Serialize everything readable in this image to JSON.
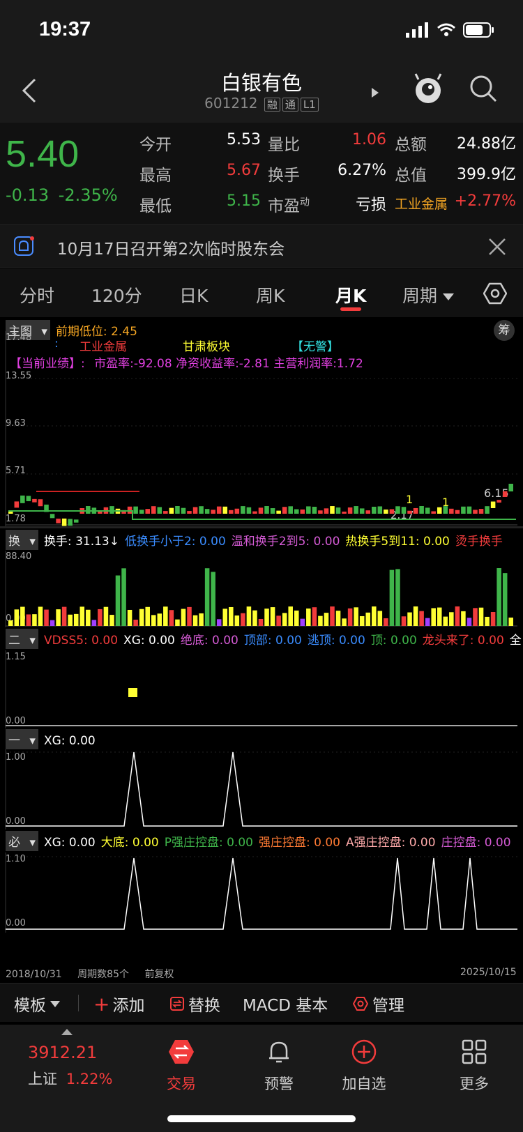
{
  "status": {
    "time": "19:37"
  },
  "header": {
    "title": "白银有色",
    "code": "601212",
    "badges": [
      "融",
      "通",
      "L1"
    ]
  },
  "quote": {
    "price": "5.40",
    "change": "-0.13",
    "change_pct": "-2.35%",
    "fields": {
      "open_label": "今开",
      "open": "5.53",
      "high_label": "最高",
      "high": "5.67",
      "low_label": "最低",
      "low": "5.15",
      "vol_ratio_label": "量比",
      "vol_ratio": "1.06",
      "turnover_label": "换手",
      "turnover": "6.27%",
      "pe_label": "市盈",
      "pe_sup": "动",
      "pe": "亏损",
      "amount_label": "总额",
      "amount": "24.88亿",
      "mktcap_label": "总值",
      "mktcap": "399.9亿",
      "sector": "工业金属",
      "sector_pct": "+2.77%"
    }
  },
  "notice": {
    "text": "10月17日召开第2次临时股东会"
  },
  "tabs": [
    "分时",
    "120分",
    "日K",
    "周K",
    "月K",
    "周期"
  ],
  "active_tab": "月K",
  "main_chart": {
    "selector": "主图",
    "prev_low": "前期低位: 2.45",
    "chou": "筹",
    "info_line1": {
      "colon": ":",
      "industry": "工业金属",
      "region": "甘肃板块",
      "warn": "【无警】"
    },
    "info_line2": {
      "label": "【当前业绩】:",
      "metrics": "市盈率:-92.08 净资收益率:-2.81 主营利润率:1.72"
    },
    "y_labels": [
      "17.48",
      "13.55",
      "9.63",
      "5.71",
      "1.78"
    ],
    "high_marker": "6.15",
    "low_marker": "2.17",
    "markers_one": [
      "1",
      "1"
    ]
  },
  "turnover_panel": {
    "selector": "换",
    "items": [
      {
        "text": "换手: 31.13↓",
        "color": "#ffffff"
      },
      {
        "text": "低换手小于2: 0.00",
        "color": "#3a8cff"
      },
      {
        "text": "温和换手2到5: 0.00",
        "color": "#d55bd5"
      },
      {
        "text": "热换手5到11: 0.00",
        "color": "#ffff33"
      },
      {
        "text": "烫手换手",
        "color": "#f23c3c"
      }
    ],
    "y_labels": [
      "88.40",
      "0.00"
    ]
  },
  "panel2": {
    "selector": "二",
    "items": [
      {
        "text": "VDSS5: 0.00",
        "color": "#f23c3c"
      },
      {
        "text": "XG: 0.00",
        "color": "#ffffff"
      },
      {
        "text": "绝底: 0.00",
        "color": "#d55bd5"
      },
      {
        "text": "顶部: 0.00",
        "color": "#3a8cff"
      },
      {
        "text": "逃顶: 0.00",
        "color": "#3a8cff"
      },
      {
        "text": "顶: 0.00",
        "color": "#3fb54a"
      },
      {
        "text": "龙头来了: 0.00",
        "color": "#f23c3c"
      },
      {
        "text": "全",
        "color": "#ffffff"
      }
    ],
    "y_labels": [
      "1.15",
      "0.00"
    ]
  },
  "panel3": {
    "selector": "一",
    "items": [
      {
        "text": "XG: 0.00",
        "color": "#ffffff"
      }
    ],
    "y_labels": [
      "1.00",
      "0.00"
    ]
  },
  "panel4": {
    "selector": "必",
    "items": [
      {
        "text": "XG: 0.00",
        "color": "#ffffff"
      },
      {
        "text": "大底: 0.00",
        "color": "#ffff33"
      },
      {
        "text": "P强庄控盘: 0.00",
        "color": "#3fb54a"
      },
      {
        "text": "强庄控盘: 0.00",
        "color": "#ff7a33"
      },
      {
        "text": "A强庄控盘: 0.00",
        "color": "#ffaaaa"
      },
      {
        "text": "庄控盘: 0.00",
        "color": "#d55bd5"
      }
    ],
    "y_labels": [
      "1.10",
      "0.00"
    ]
  },
  "footer_axis": {
    "start": "2018/10/31",
    "periods": "周期数85个",
    "adjust": "前复权",
    "end": "2025/10/15"
  },
  "toolbar": {
    "template": "模板",
    "add": "添加",
    "replace": "替换",
    "macd": "MACD 基本",
    "manage": "管理"
  },
  "bottom_nav": {
    "index_value": "3912.21",
    "index_name": "上证",
    "index_pct": "1.22%",
    "items": [
      "交易",
      "预警",
      "加自选",
      "更多"
    ]
  },
  "colors": {
    "up": "#f23c3c",
    "down": "#3fb54a",
    "accent": "#f5a623"
  }
}
